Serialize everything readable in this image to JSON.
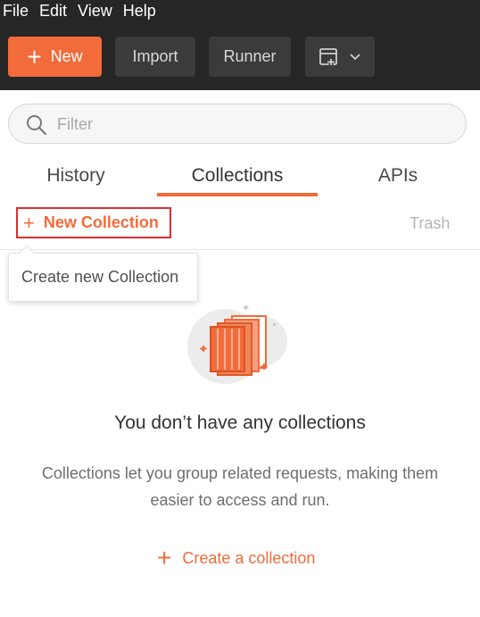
{
  "menu": {
    "items": [
      "File",
      "Edit",
      "View",
      "Help"
    ]
  },
  "toolbar": {
    "new_label": "New",
    "import_label": "Import",
    "runner_label": "Runner"
  },
  "search": {
    "placeholder": "Filter"
  },
  "tabs": [
    {
      "label": "History"
    },
    {
      "label": "Collections",
      "active": true
    },
    {
      "label": "APIs"
    }
  ],
  "collections": {
    "new_collection_label": "New Collection",
    "trash_label": "Trash",
    "tooltip": "Create new Collection",
    "empty_title": "You don’t have any collections",
    "empty_desc_line1": "Collections let you group related requests, making them",
    "empty_desc_line2": "easier to access and run.",
    "create_label": "Create a collection"
  },
  "colors": {
    "accent": "#f26b3a",
    "toolbar_bg": "#262626",
    "highlight_border": "#d93030"
  }
}
